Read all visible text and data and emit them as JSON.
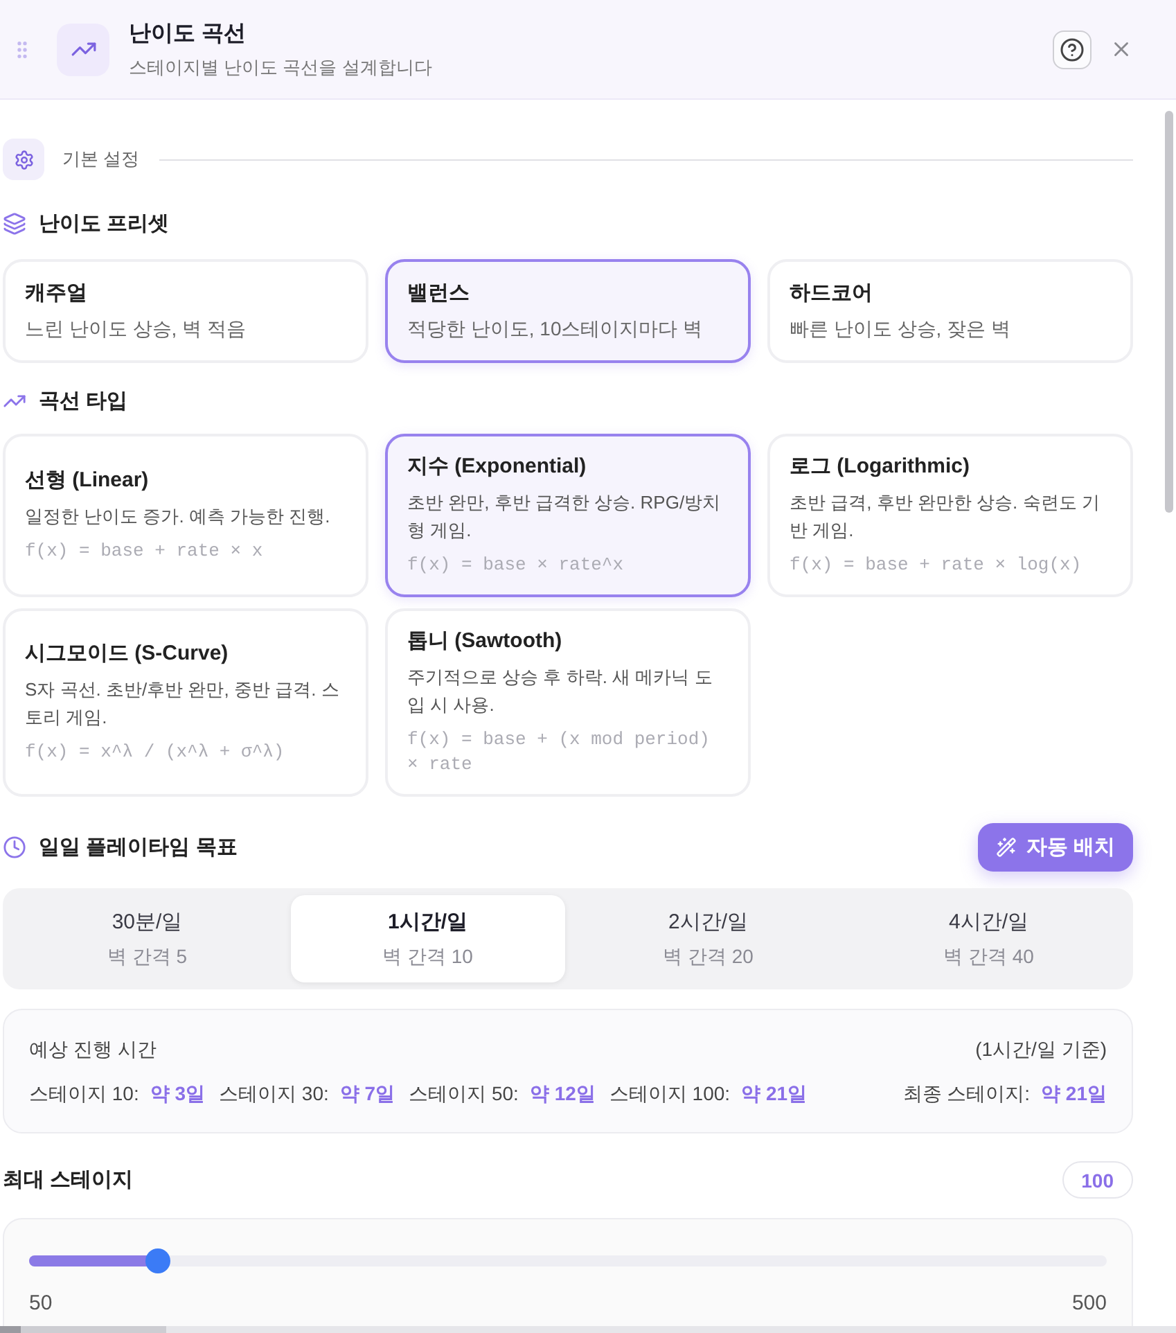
{
  "header": {
    "title": "난이도 곡선",
    "subtitle": "스테이지별 난이도 곡선을 설계합니다"
  },
  "basic_settings": {
    "label": "기본 설정"
  },
  "presets": {
    "heading": "난이도 프리셋",
    "items": [
      {
        "title": "캐주얼",
        "description": "느린 난이도 상승, 벽 적음",
        "selected": false
      },
      {
        "title": "밸런스",
        "description": "적당한 난이도, 10스테이지마다 벽",
        "selected": true
      },
      {
        "title": "하드코어",
        "description": "빠른 난이도 상승, 잦은 벽",
        "selected": false
      }
    ]
  },
  "curve_types": {
    "heading": "곡선 타입",
    "items": [
      {
        "title": "선형 (Linear)",
        "description": "일정한 난이도 증가. 예측 가능한 진행.",
        "formula": "f(x) = base + rate × x",
        "selected": false
      },
      {
        "title": "지수 (Exponential)",
        "description": "초반 완만, 후반 급격한 상승. RPG/방치형 게임.",
        "formula": "f(x) = base × rate^x",
        "selected": true
      },
      {
        "title": "로그 (Logarithmic)",
        "description": "초반 급격, 후반 완만한 상승. 숙련도 기반 게임.",
        "formula": "f(x) = base + rate × log(x)",
        "selected": false
      },
      {
        "title": "시그모이드 (S-Curve)",
        "description": "S자 곡선. 초반/후반 완만, 중반 급격. 스토리 게임.",
        "formula": "f(x) = x^λ / (x^λ + σ^λ)",
        "selected": false
      },
      {
        "title": "톱니 (Sawtooth)",
        "description": "주기적으로 상승 후 하락. 새 메카닉 도입 시 사용.",
        "formula": "f(x) = base + (x mod period) × rate",
        "selected": false
      }
    ]
  },
  "playtime": {
    "heading": "일일 플레이타임 목표",
    "auto_button": "자동 배치",
    "options": [
      {
        "label": "30분/일",
        "wall_interval": "벽 간격 5",
        "selected": false
      },
      {
        "label": "1시간/일",
        "wall_interval": "벽 간격 10",
        "selected": true
      },
      {
        "label": "2시간/일",
        "wall_interval": "벽 간격 20",
        "selected": false
      },
      {
        "label": "4시간/일",
        "wall_interval": "벽 간격 40",
        "selected": false
      }
    ]
  },
  "estimate": {
    "title": "예상 진행 시간",
    "basis": "(1시간/일 기준)",
    "milestones": [
      {
        "label": "스테이지 10:",
        "value": "약 3일"
      },
      {
        "label": "스테이지 30:",
        "value": "약 7일"
      },
      {
        "label": "스테이지 50:",
        "value": "약 12일"
      },
      {
        "label": "스테이지 100:",
        "value": "약 21일"
      }
    ],
    "final": {
      "label": "최종 스테이지:",
      "value": "약 21일"
    }
  },
  "max_stage": {
    "label": "최대 스테이지",
    "value": "100",
    "slider": {
      "level": 0.111,
      "min_label": "50",
      "max_label": "500"
    }
  }
}
